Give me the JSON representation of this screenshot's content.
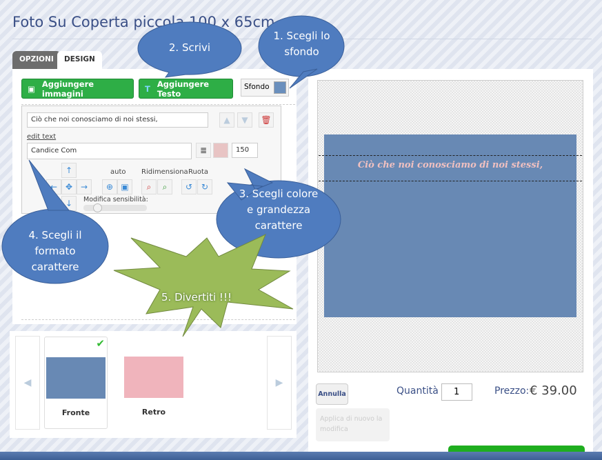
{
  "title": "Foto Su Coperta piccola 100 x 65cm",
  "tabs": [
    {
      "label": "OPZIONI"
    },
    {
      "label": "DESIGN"
    }
  ],
  "toolbar": {
    "add_images": "Aggiungere immagini",
    "add_text": "Aggiungere Testo",
    "background_label": "Sfondo",
    "background_color": "#6a8fbd"
  },
  "editor": {
    "text_value": "Ciò che noi conosciamo di noi stessi,",
    "edit_text_link": "edit text",
    "font_value": "Candice Com",
    "font_color": "#e8c4c4",
    "font_size": "150",
    "auto_label": "auto",
    "resize_label": "Ridimensiona",
    "rotate_label": "Ruota",
    "sensitivity_label": "Modifica sensibilità:"
  },
  "canvas": {
    "text": "Ciò che noi conosciamo di noi stessi,",
    "background_color": "#6889b4",
    "text_color": "#f0c0c0"
  },
  "thumbnails": [
    {
      "label": "Fronte",
      "selected": true
    },
    {
      "label": "Retro",
      "selected": false
    }
  ],
  "actions": {
    "cancel": "Annulla",
    "reapply": "Applica di nuovo la modifica",
    "quantity_label": "Quantità",
    "quantity_value": "1",
    "price_label": "Prezzo:",
    "price_value": "€ 39.00"
  },
  "callouts": {
    "c1": "1. Scegli lo sfondo",
    "c2": "2. Scrivi",
    "c3": "3. Scegli colore e grandezza carattere",
    "c4": "4. Scegli il formato carattere",
    "c5": "5. Divertiti !!!"
  }
}
